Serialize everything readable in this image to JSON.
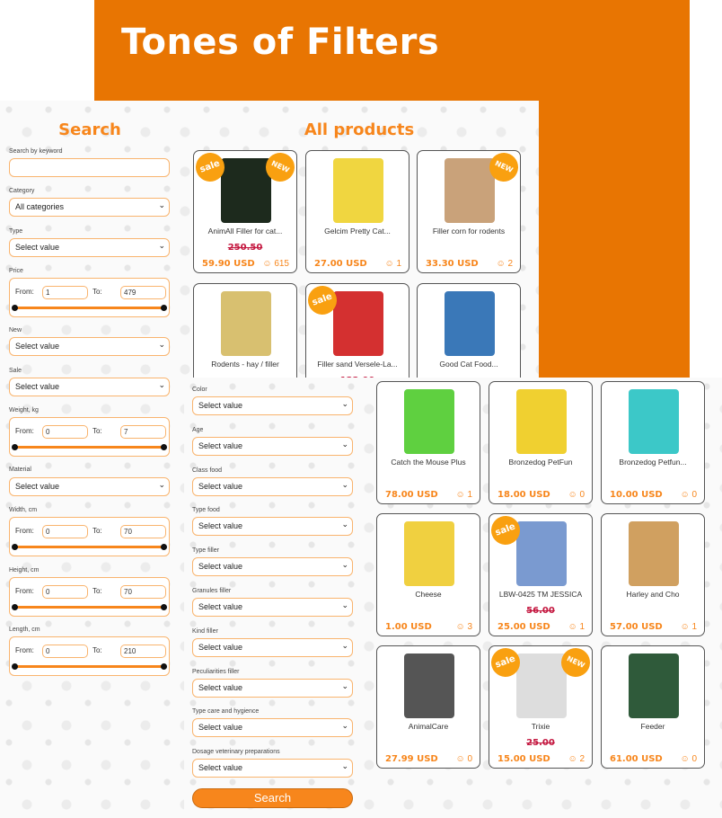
{
  "banner": {
    "title": "Tones of Filters"
  },
  "colors": {
    "accent": "#f7861c",
    "banner": "#e87502",
    "old_price": "#c41840"
  },
  "search": {
    "heading": "Search",
    "keyword_label": "Search by keyword",
    "keyword_value": "",
    "category_label": "Category",
    "category_value": "All categories",
    "type_label": "Type",
    "select_value": "Select value",
    "price_label": "Price",
    "from": "From:",
    "to": "To:",
    "price_from": "1",
    "price_to": "479",
    "new_label": "New",
    "sale_label": "Sale",
    "weight_label": "Weight, kg",
    "weight_from": "0",
    "weight_to": "7",
    "material_label": "Material",
    "width_label": "Width, cm",
    "width_from": "0",
    "width_to": "70",
    "height_label": "Height, cm",
    "height_from": "0",
    "height_to": "70",
    "length_label": "Length, cm",
    "length_from": "0",
    "length_to": "210"
  },
  "more_filters": {
    "labels": [
      "Color",
      "Age",
      "Class food",
      "Type food",
      "Type filler",
      "Granules filler",
      "Kind filler",
      "Peculiarities filler",
      "Type care and hygience",
      "Dosage veterinary preparations"
    ],
    "select_value": "Select value",
    "search_button": "Search"
  },
  "products_heading": "All products",
  "products_top": [
    {
      "name": "AnimAll Filler for cat...",
      "old": "250.50",
      "price": "59.90 USD",
      "reviews": "615",
      "sale": true,
      "new": true,
      "color": "#1d2a1d"
    },
    {
      "name": "Gelcim Pretty Cat...",
      "price": "27.00 USD",
      "reviews": "1",
      "color": "#f0d640"
    },
    {
      "name": "Filler corn for rodents",
      "price": "33.30 USD",
      "reviews": "2",
      "new": true,
      "color": "#c9a27a"
    },
    {
      "name": "Rodents - hay / filler",
      "color": "#d8c070"
    },
    {
      "name": "Filler sand Versele-La...",
      "old": "122.00",
      "sale": true,
      "color": "#d43030"
    },
    {
      "name": "Good Cat Food...",
      "color": "#3a78b8"
    }
  ],
  "products_bottom": [
    {
      "name": "Catch the Mouse Plus",
      "price": "78.00 USD",
      "reviews": "1",
      "color": "#5fd040"
    },
    {
      "name": "Bronzedog PetFun",
      "price": "18.00 USD",
      "reviews": "0",
      "color": "#f0d030"
    },
    {
      "name": "Bronzedog Petfun...",
      "price": "10.00 USD",
      "reviews": "0",
      "color": "#3cc8c8"
    },
    {
      "name": "Cheese",
      "price": "1.00 USD",
      "reviews": "3",
      "color": "#f0d040"
    },
    {
      "name": "LBW-0425 TM JESSICA",
      "old": "56.00",
      "price": "25.00 USD",
      "reviews": "1",
      "sale": true,
      "color": "#7a9ad0"
    },
    {
      "name": "Harley and Cho",
      "price": "57.00 USD",
      "reviews": "1",
      "color": "#d0a060"
    },
    {
      "name": "AnimalCare",
      "price": "27.99 USD",
      "reviews": "0",
      "color": "#555555"
    },
    {
      "name": "Trixie",
      "old": "25.00",
      "price": "15.00 USD",
      "reviews": "2",
      "sale": true,
      "new": true,
      "color": "#dddddd"
    },
    {
      "name": "Feeder",
      "price": "61.00 USD",
      "reviews": "0",
      "color": "#2f5a3a"
    }
  ],
  "badges": {
    "sale": "sale",
    "new": "NEW"
  }
}
